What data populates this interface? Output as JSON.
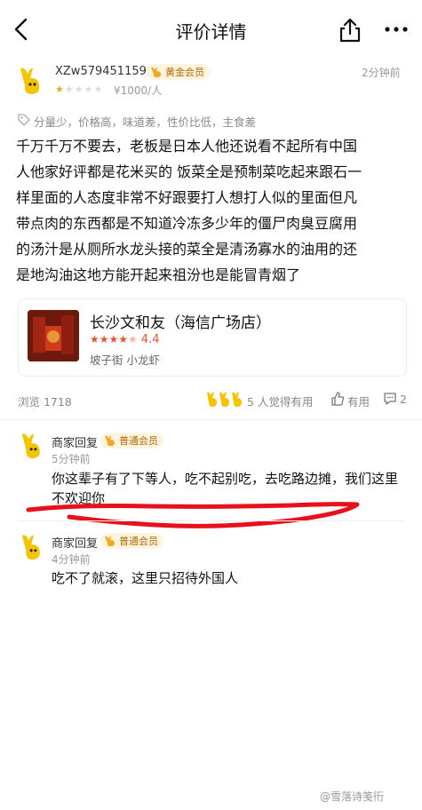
{
  "header": {
    "title": "评价详情"
  },
  "review": {
    "username": "XZw579451159",
    "member_badge": "黄金会员",
    "time": "2分钟前",
    "rating": 1,
    "rating_max": 5,
    "price": "¥1000/人",
    "tags": "分量少，价格高，味道差，性价比低，主食差",
    "lines": [
      "千万千万不要去，老板是日本人他还说看不起所有中国",
      "人他家好评都是花米买的 饭菜全是预制菜吃起来跟石一",
      "样里面的人态度非常不好跟要打人想打人似的里面但凡",
      "带点肉的东西都是不知道冷冻多少年的僵尸肉臭豆腐用",
      "的汤汁是从厕所水龙头接的菜全是清汤寡水的油用的还",
      "是地沟油这地方能开起来祖汾也是能冒青烟了"
    ]
  },
  "shop": {
    "name": "长沙文和友（海信广场店）",
    "score": "4.4",
    "rating": 4.4,
    "tags": "坡子街  小龙虾"
  },
  "stats": {
    "views": "浏览 1718",
    "liked_by": "5 人觉得有用",
    "useful_label": "有用",
    "comment_count": "2"
  },
  "replies": [
    {
      "author": "商家回复",
      "badge": "普通会员",
      "time": "5分钟前",
      "lines": [
        "你这辈子有了下等人，吃不起别吃，去吃路边摊，我们这里",
        "不欢迎你"
      ]
    },
    {
      "author": "商家回复",
      "badge": "普通会员",
      "time": "4分钟前",
      "lines": [
        "吃不了就滚，这里只招待外国人"
      ]
    }
  ],
  "watermark": "@雪落诗笺衎",
  "colors": {
    "accent": "#f5a623",
    "badge_bg": "#fff4e0",
    "annotation_red": "#e8111b"
  },
  "icons": [
    "back-icon",
    "share-icon",
    "more-icon",
    "mascot-avatar",
    "tag-icon",
    "thumb-up-icon",
    "comment-icon"
  ]
}
